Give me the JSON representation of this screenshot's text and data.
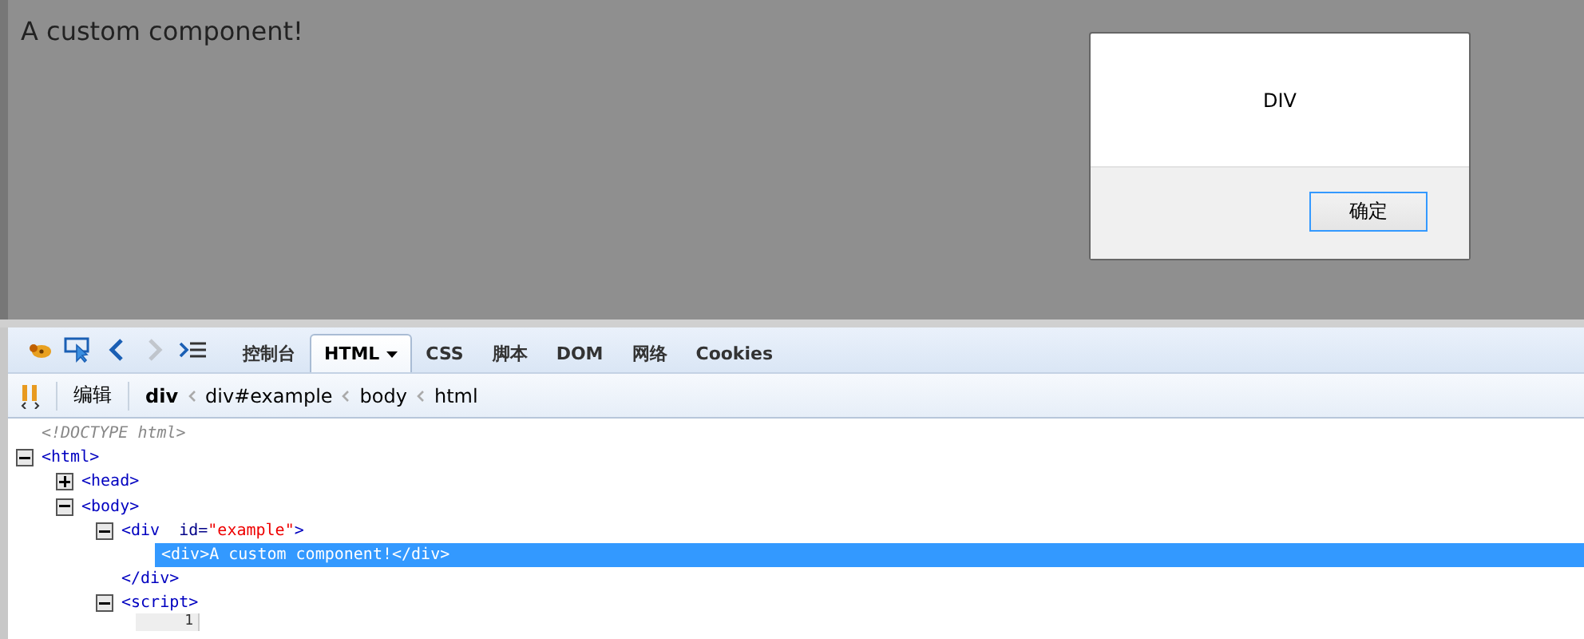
{
  "page": {
    "heading": "A custom component!"
  },
  "dialog": {
    "message": "DIV",
    "buttons": [
      {
        "label": "确定",
        "focused": true
      }
    ]
  },
  "devtools": {
    "toolbar_icons": [
      {
        "kind": "bug",
        "disabled": false
      },
      {
        "kind": "inspect",
        "disabled": false
      },
      {
        "kind": "back",
        "disabled": false
      },
      {
        "kind": "forward",
        "disabled": true
      },
      {
        "kind": "console",
        "disabled": false
      }
    ],
    "tabs": [
      {
        "label": "控制台",
        "selected": false,
        "menu": false
      },
      {
        "label": "HTML",
        "selected": true,
        "menu": true
      },
      {
        "label": "CSS",
        "selected": false,
        "menu": false
      },
      {
        "label": "脚本",
        "selected": false,
        "menu": false
      },
      {
        "label": "DOM",
        "selected": false,
        "menu": false
      },
      {
        "label": "网络",
        "selected": false,
        "menu": false
      },
      {
        "label": "Cookies",
        "selected": false,
        "menu": false
      }
    ],
    "edit_button": "编辑",
    "breadcrumbs": [
      {
        "label": "div",
        "selected": true
      },
      {
        "label": "div#example",
        "selected": false
      },
      {
        "label": "body",
        "selected": false
      },
      {
        "label": "html",
        "selected": false
      }
    ],
    "tree": [
      {
        "kind": "doctype",
        "text": "<!DOCTYPE html>"
      },
      {
        "kind": "element",
        "tag": "<html>",
        "expanded": true,
        "children": [
          {
            "kind": "element",
            "tag": "<head>",
            "expanded": false
          },
          {
            "kind": "element",
            "tag": "<body>",
            "expanded": true,
            "children": [
              {
                "kind": "element",
                "tag": "<div",
                "attrs": [
                  {
                    "name": "id=",
                    "value": "\"example\""
                  }
                ],
                "end": ">",
                "expanded": true,
                "close": "</div>",
                "children": [
                  {
                    "kind": "inline",
                    "text": "<div>A custom component!</div>",
                    "selected": true
                  }
                ]
              },
              {
                "kind": "element",
                "tag": "<script>",
                "expanded": true,
                "children": [
                  {
                    "kind": "code",
                    "line_number": "1"
                  }
                ]
              }
            ]
          }
        ]
      }
    ]
  }
}
